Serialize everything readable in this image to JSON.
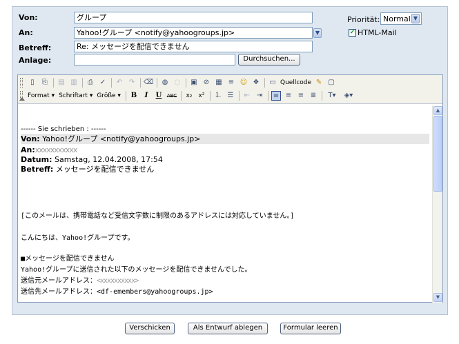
{
  "header": {
    "von_label": "Von:",
    "von_value": "グループ",
    "an_label": "An:",
    "an_value": "Yahoo!グループ <notify@yahoogroups.jp>",
    "betreff_label": "Betreff:",
    "betreff_value": "Re: メッセージを配信できません",
    "anlage_label": "Anlage:",
    "anlage_value": "",
    "browse_label": "Durchsuchen...",
    "priority_label": "Priorität:",
    "priority_value": "Normal",
    "html_mail_label": "HTML-Mail",
    "html_mail_checked": true
  },
  "toolbar": {
    "source_label": "Quellcode",
    "format_label": "Format",
    "font_label": "Schriftart",
    "size_label": "Größe",
    "bold": "B",
    "italic": "I",
    "underline": "U",
    "strike": "ABC"
  },
  "body": {
    "quote_header": "------ Sie schrieben : ------",
    "von_label": "Von:",
    "von_value": " Yahoo!グループ <notify@yahoogroups.jp>",
    "an_label": "An:",
    "an_value": "xxxxxxxxxxx",
    "datum_label": "Datum:",
    "datum_value": " Samstag, 12.04.2008, 17:54",
    "betreff_label": "Betreff:",
    "betreff_value": " メッセージを配信できません",
    "notice": "[このメールは、携帯電話など受信文字数に制限のあるアドレスには対応していません。]",
    "greeting": "こんにちは、Yahoo!グループです。",
    "section_title": "■メッセージを配信できません",
    "section_text": "Yahoo!グループに送信された以下のメッセージを配信できませんでした。",
    "sender_label": "送信元メールアドレス：",
    "sender_value": "<xxxxxxxxxx>",
    "recipient_label": "送信先メールアドレス：",
    "recipient_value": "<df-emembers@yahoogroups.jp>"
  },
  "actions": {
    "send": "Verschicken",
    "draft": "Als Entwurf ablegen",
    "clear": "Formular leeren"
  }
}
